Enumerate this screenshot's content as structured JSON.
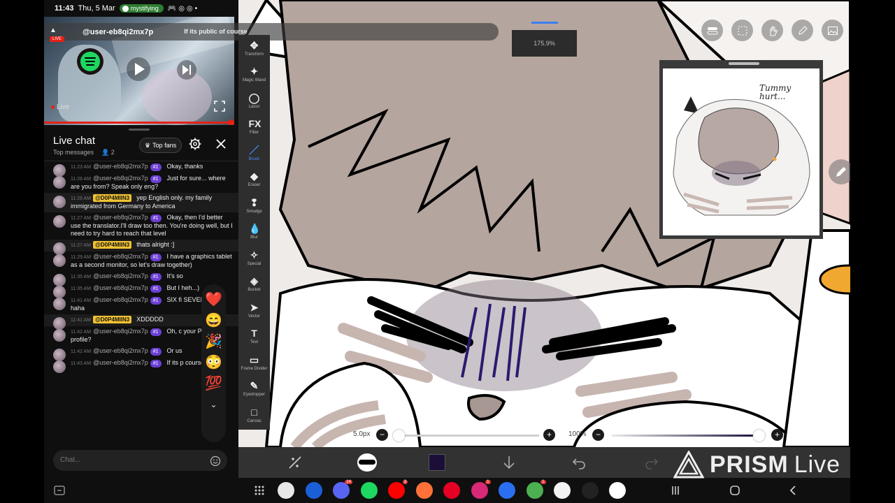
{
  "status_bar": {
    "time": "11:43",
    "date": "Thu, 5 Mar",
    "app_pill": "mystifying"
  },
  "video": {
    "live_badge": "LIVE",
    "banner_user": "@user-eb8qi2mx7p",
    "banner_message": "If its public of course",
    "live_label": "Live"
  },
  "chat": {
    "title": "Live chat",
    "subtitle": "Top messages",
    "viewer_count": "2",
    "top_fans_label": "Top fans",
    "input_placeholder": "Chat...",
    "messages": [
      {
        "time": "11:23 AM",
        "user": "@user-eb8qi2mx7p",
        "badge": "#1",
        "owner": false,
        "text": "Okay, thanks"
      },
      {
        "time": "11:26 AM",
        "user": "@user-eb8qi2mx7p",
        "badge": "#1",
        "owner": false,
        "text": "Just for sure... where are you from? Speak only eng?"
      },
      {
        "time": "11:26 AM",
        "user": "@D0P4MIIN3",
        "badge": "",
        "owner": true,
        "text": "yep English only. my family immigrated from Germany to America"
      },
      {
        "time": "11:27 AM",
        "user": "@user-eb8qi2mx7p",
        "badge": "#1",
        "owner": false,
        "text": "Okay, then I'd better use the translator.I'll draw too then. You're doing well, but I need to try hard to reach that level"
      },
      {
        "time": "11:27 AM",
        "user": "@D0P4MIIN3",
        "badge": "",
        "owner": true,
        "text": "thats alright :]"
      },
      {
        "time": "11:29 AM",
        "user": "@user-eb8qi2mx7p",
        "badge": "#1",
        "owner": false,
        "text": "I have a graphics tablet as a second monitor, so let's draw together)"
      },
      {
        "time": "11:35 AM",
        "user": "@user-eb8qi2mx7p",
        "badge": "#1",
        "owner": false,
        "text": "It's so"
      },
      {
        "time": "11:35 AM",
        "user": "@user-eb8qi2mx7p",
        "badge": "#1",
        "owner": false,
        "text": "But I heh...)"
      },
      {
        "time": "11:41 AM",
        "user": "@user-eb8qi2mx7p",
        "badge": "#1",
        "owner": false,
        "text": "SIX fi SEVEN sorry... haha"
      },
      {
        "time": "11:41 AM",
        "user": "@D0P4MIIN3",
        "badge": "",
        "owner": true,
        "text": "XDDDDD"
      },
      {
        "time": "11:42 AM",
        "user": "@user-eb8qi2mx7p",
        "badge": "#1",
        "owner": false,
        "text": "Oh, c your Pinterest profile?"
      },
      {
        "time": "11:42 AM",
        "user": "@user-eb8qi2mx7p",
        "badge": "#1",
        "owner": false,
        "text": "Or us"
      },
      {
        "time": "11:43 AM",
        "user": "@user-eb8qi2mx7p",
        "badge": "#1",
        "owner": false,
        "text": "If its p course"
      }
    ],
    "reactions": [
      "❤️",
      "😄",
      "🎉",
      "😳",
      "💯"
    ]
  },
  "app": {
    "zoom": "175.9%",
    "tools": [
      "Transform",
      "Magic Wand",
      "Lasso",
      "Filter",
      "Brush",
      "Eraser",
      "Smudge",
      "Blur",
      "Special",
      "Bucket",
      "Vector",
      "Text",
      "Frame Divider",
      "Eyedropper",
      "Canvas"
    ],
    "active_tool": "Brush",
    "preview_caption": "Tummy hurt...",
    "brush_size": "5.0px",
    "brush_size_fraction": 0.02,
    "opacity": "100%",
    "opacity_fraction": 1.0,
    "current_color": "#1b0f3a",
    "brush_thumb_label": "5.0"
  },
  "watermark": {
    "brand": "PRISM",
    "suffix": "Live"
  },
  "navbar": {
    "apps": [
      {
        "name": "galaxy-store-icon",
        "color": "#e8e8e8",
        "badge": ""
      },
      {
        "name": "ibis-paint-icon",
        "color": "#1a5fd6",
        "badge": ""
      },
      {
        "name": "discord-icon",
        "color": "#5865f2",
        "badge": "14"
      },
      {
        "name": "spotify-icon",
        "color": "#1ed760",
        "badge": ""
      },
      {
        "name": "youtube-icon",
        "color": "#ff0000",
        "badge": "3"
      },
      {
        "name": "firefox-icon",
        "color": "#ff7139",
        "badge": ""
      },
      {
        "name": "pinterest-icon",
        "color": "#e60023",
        "badge": ""
      },
      {
        "name": "instagram-icon",
        "color": "#d62976",
        "badge": "1"
      },
      {
        "name": "samsung-app-icon",
        "color": "#2a6ff0",
        "badge": ""
      },
      {
        "name": "chrome-icon",
        "color": "#4caf50",
        "badge": "1"
      },
      {
        "name": "youtube-studio-icon",
        "color": "#f2f2f2",
        "badge": ""
      },
      {
        "name": "prism-live-icon",
        "color": "#222222",
        "badge": ""
      },
      {
        "name": "google-icon",
        "color": "#ffffff",
        "badge": ""
      }
    ]
  }
}
